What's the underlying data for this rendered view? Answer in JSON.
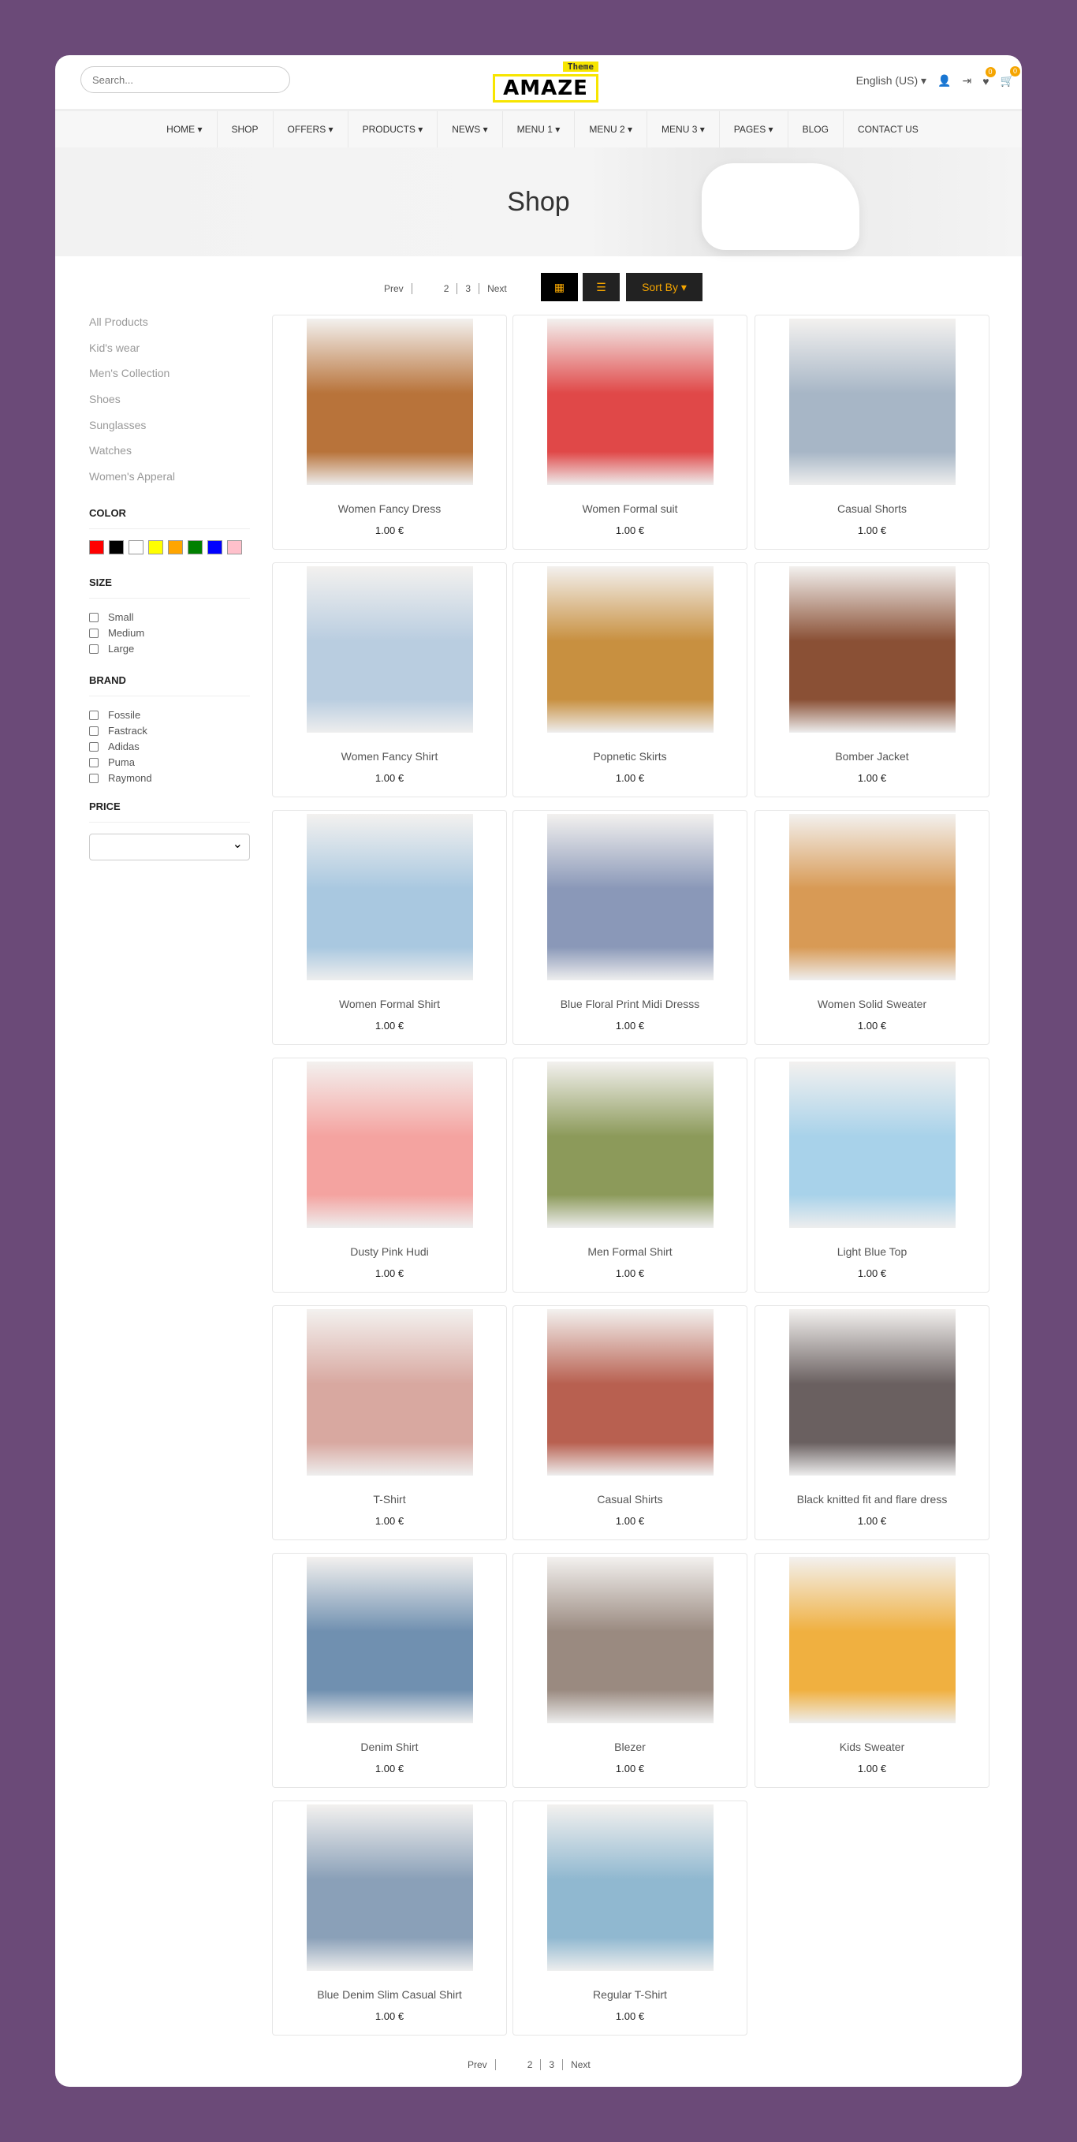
{
  "header": {
    "search_placeholder": "Search...",
    "logo_tag": "Theme",
    "logo_text": "AMAZE",
    "language": "English (US) ▾",
    "wishlist_count": "0",
    "cart_count": "0"
  },
  "nav": [
    "HOME ▾",
    "SHOP",
    "OFFERS ▾",
    "PRODUCTS ▾",
    "NEWS ▾",
    "MENU 1 ▾",
    "MENU 2 ▾",
    "MENU 3 ▾",
    "PAGES ▾",
    "BLOG",
    "CONTACT US"
  ],
  "banner": {
    "title": "Shop"
  },
  "pagination": {
    "prev": "Prev",
    "pages": [
      "",
      "2",
      "3"
    ],
    "next": "Next"
  },
  "toolbar": {
    "sort_label": "Sort By ▾"
  },
  "sidebar": {
    "categories": [
      "All Products",
      "Kid's wear",
      "Men's Collection",
      "Shoes",
      "Sunglasses",
      "Watches",
      "Women's Apperal"
    ],
    "color_title": "COLOR",
    "colors": [
      "#ff0000",
      "#000000",
      "#ffffff",
      "#ffff00",
      "#ffa500",
      "#008000",
      "#0000ff",
      "#ffc0cb"
    ],
    "size_title": "SIZE",
    "sizes": [
      "Small",
      "Medium",
      "Large"
    ],
    "brand_title": "BRAND",
    "brands": [
      "Fossile",
      "Fastrack",
      "Adidas",
      "Puma",
      "Raymond"
    ],
    "price_title": "PRICE",
    "price_value": ""
  },
  "products": [
    {
      "name": "Women Fancy Dress",
      "price": "1.00 €",
      "color": "#b8733a"
    },
    {
      "name": "Women Formal suit",
      "price": "1.00 €",
      "color": "#e04848"
    },
    {
      "name": "Casual Shorts",
      "price": "1.00 €",
      "color": "#a7b6c6"
    },
    {
      "name": "Women Fancy Shirt",
      "price": "1.00 €",
      "color": "#b9cde0"
    },
    {
      "name": "Popnetic Skirts",
      "price": "1.00 €",
      "color": "#c89040"
    },
    {
      "name": "Bomber Jacket",
      "price": "1.00 €",
      "color": "#8a5035"
    },
    {
      "name": "Women Formal Shirt",
      "price": "1.00 €",
      "color": "#a9c8e0"
    },
    {
      "name": "Blue Floral Print Midi Dresss",
      "price": "1.00 €",
      "color": "#8a98b8"
    },
    {
      "name": "Women Solid Sweater",
      "price": "1.00 €",
      "color": "#d89a55"
    },
    {
      "name": "Dusty Pink Hudi",
      "price": "1.00 €",
      "color": "#f4a3a0"
    },
    {
      "name": "Men Formal Shirt",
      "price": "1.00 €",
      "color": "#8c9a5a"
    },
    {
      "name": "Light Blue Top",
      "price": "1.00 €",
      "color": "#a8d2ea"
    },
    {
      "name": "T-Shirt",
      "price": "1.00 €",
      "color": "#d8a8a0"
    },
    {
      "name": "Casual Shirts",
      "price": "1.00 €",
      "color": "#b86050"
    },
    {
      "name": "Black knitted fit and flare dress",
      "price": "1.00 €",
      "color": "#6a6060"
    },
    {
      "name": "Denim Shirt",
      "price": "1.00 €",
      "color": "#7090b0"
    },
    {
      "name": "Blezer",
      "price": "1.00 €",
      "color": "#9a8a80"
    },
    {
      "name": "Kids Sweater",
      "price": "1.00 €",
      "color": "#f0b040"
    },
    {
      "name": "Blue Denim Slim Casual Shirt",
      "price": "1.00 €",
      "color": "#8aa0b8"
    },
    {
      "name": "Regular T-Shirt",
      "price": "1.00 €",
      "color": "#90b8d0"
    }
  ]
}
